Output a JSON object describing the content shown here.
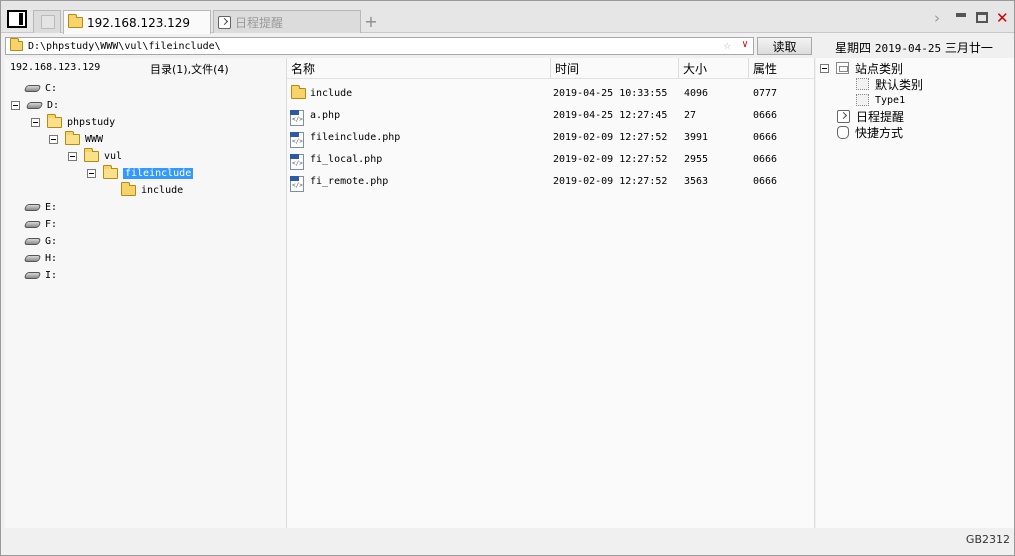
{
  "tabs": [
    {
      "label": "192.168.123.129",
      "active": true
    },
    {
      "label": "日程提醒",
      "active": false
    }
  ],
  "add_tab_label": "+",
  "window_controls": {
    "next": "›",
    "close": "✕"
  },
  "address": {
    "path": "D:\\phpstudy\\WWW\\vul\\fileinclude\\",
    "star": "☆",
    "dropdown": "∨",
    "read_label": "读取"
  },
  "date": {
    "weekday": "星期四",
    "date": "2019-04-25",
    "lunar": "三月廿一"
  },
  "tree_header": {
    "host": "192.168.123.129",
    "counts": "目录(1),文件(4)"
  },
  "tree": [
    {
      "label": "C:"
    },
    {
      "label": "D:"
    },
    {
      "label": "phpstudy"
    },
    {
      "label": "WWW"
    },
    {
      "label": "vul"
    },
    {
      "label": "fileinclude"
    },
    {
      "label": "include"
    },
    {
      "label": "E:"
    },
    {
      "label": "F:"
    },
    {
      "label": "G:"
    },
    {
      "label": "H:"
    },
    {
      "label": "I:"
    }
  ],
  "columns": {
    "name": "名称",
    "time": "时间",
    "size": "大小",
    "attr": "属性"
  },
  "files": [
    {
      "name": "include",
      "time": "2019-04-25 10:33:55",
      "size": "4096",
      "attr": "0777",
      "type": "folder"
    },
    {
      "name": "a.php",
      "time": "2019-04-25 12:27:45",
      "size": "27",
      "attr": "0666",
      "type": "php"
    },
    {
      "name": "fileinclude.php",
      "time": "2019-02-09 12:27:52",
      "size": "3991",
      "attr": "0666",
      "type": "php"
    },
    {
      "name": "fi_local.php",
      "time": "2019-02-09 12:27:52",
      "size": "2955",
      "attr": "0666",
      "type": "php"
    },
    {
      "name": "fi_remote.php",
      "time": "2019-02-09 12:27:52",
      "size": "3563",
      "attr": "0666",
      "type": "php"
    }
  ],
  "sidebar": {
    "site_category": "站点类别",
    "default_category": "默认类别",
    "type1": "Type1",
    "schedule": "日程提醒",
    "shortcuts": "快捷方式"
  },
  "status": {
    "encoding": "GB2312"
  },
  "colors": {
    "selection": "#3399ff",
    "close": "#d00000",
    "folder": "#f7d36a"
  }
}
